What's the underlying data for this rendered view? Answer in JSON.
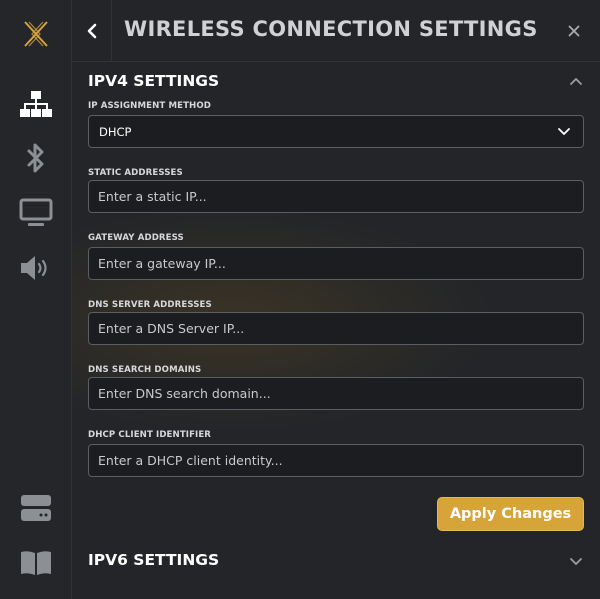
{
  "header": {
    "title": "WIRELESS CONNECTION SETTINGS"
  },
  "sidebar": {
    "logo": "x-logo",
    "items": [
      {
        "icon": "network-icon",
        "active": true
      },
      {
        "icon": "bluetooth-icon",
        "active": false
      },
      {
        "icon": "monitor-icon",
        "active": false
      },
      {
        "icon": "speaker-icon",
        "active": false
      },
      {
        "icon": "server-icon",
        "active": false
      },
      {
        "icon": "book-icon",
        "active": false
      }
    ]
  },
  "ipv4": {
    "title": "IPV4 SETTINGS",
    "expanded": true,
    "assignment_label": "IP ASSIGNMENT METHOD",
    "assignment_value": "DHCP",
    "static_label": "STATIC ADDRESSES",
    "static_placeholder": "Enter a static IP...",
    "gateway_label": "GATEWAY ADDRESS",
    "gateway_placeholder": "Enter a gateway IP...",
    "dns_label": "DNS SERVER ADDRESSES",
    "dns_placeholder": "Enter a DNS Server IP...",
    "search_label": "DNS SEARCH DOMAINS",
    "search_placeholder": "Enter DNS search domain...",
    "client_label": "DHCP CLIENT IDENTIFIER",
    "client_placeholder": "Enter a DHCP client identity...",
    "apply_label": "Apply Changes"
  },
  "ipv6": {
    "title": "IPV6 SETTINGS",
    "expanded": false
  },
  "colors": {
    "accent": "#d7a43a",
    "background": "#232528",
    "border": "#5a5d62"
  }
}
